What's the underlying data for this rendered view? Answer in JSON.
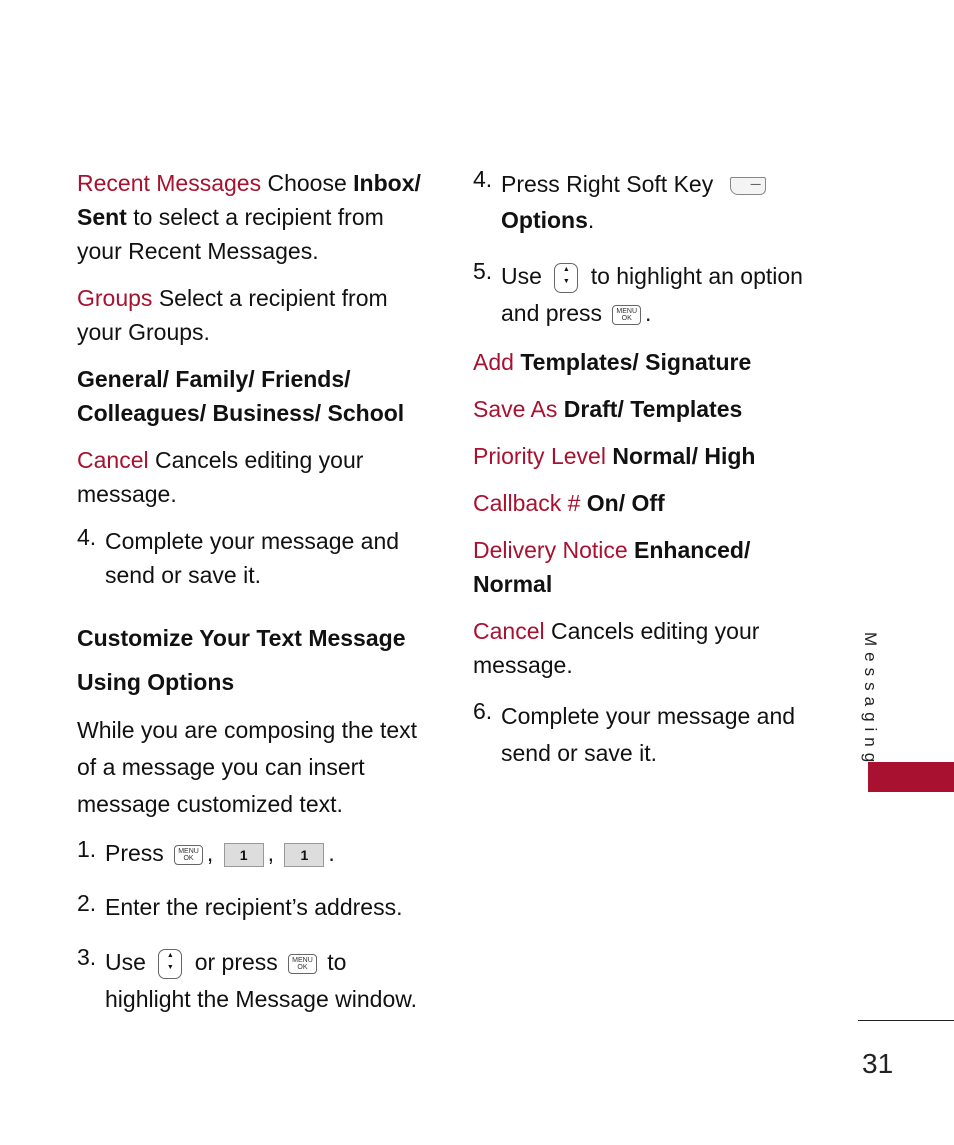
{
  "left": {
    "recent": {
      "term": "Recent Messages",
      "pre": "Choose",
      "opt": "Inbox/ Sent",
      "post": "to select a recipient from your Recent Messages."
    },
    "groups": {
      "term": "Groups",
      "desc": "Select a recipient from your Groups."
    },
    "group_list": "General/ Family/ Friends/ Colleagues/ Business/ School",
    "cancel": {
      "term": "Cancel",
      "desc": "Cancels editing your message."
    },
    "step4": {
      "num": "4.",
      "text": "Complete your message and send or save it."
    },
    "heading": "Customize Your Text Message Using Options",
    "intro": "While you are composing the text of a message you can insert message customized text.",
    "step1": {
      "num": "1.",
      "text": "Press",
      "sep1": ",",
      "sep2": ",",
      "end": "."
    },
    "step2": {
      "num": "2.",
      "text": "Enter the recipient’s address."
    },
    "step3": {
      "num": "3.",
      "pre": "Use",
      "mid": "or press",
      "post": "to highlight the Message window."
    }
  },
  "right": {
    "step4": {
      "num": "4.",
      "text": "Press Right Soft Key",
      "opt": "Options",
      "end": "."
    },
    "step5": {
      "num": "5.",
      "pre": "Use",
      "mid": "to highlight an option and press",
      "end": "."
    },
    "options": [
      {
        "term": "Add",
        "value": "Templates/ Signature"
      },
      {
        "term": "Save As",
        "value": "Draft/ Templates"
      },
      {
        "term": "Priority Level",
        "value": "Normal/ High"
      },
      {
        "term": "Callback #",
        "value": "On/ Off"
      },
      {
        "term": "Delivery Notice",
        "value": "Enhanced/ Normal"
      }
    ],
    "cancel": {
      "term": "Cancel",
      "desc": "Cancels editing your message."
    },
    "step6": {
      "num": "6.",
      "text": "Complete your message and send or save it."
    }
  },
  "keys": {
    "menu_top": "MENU",
    "menu_bottom": "OK",
    "one": "1",
    "nav_up": "▲",
    "nav_down": "▼",
    "soft": "—"
  },
  "section_tab": "Messaging",
  "page_number": "31",
  "colors": {
    "accent": "#a8112f"
  }
}
